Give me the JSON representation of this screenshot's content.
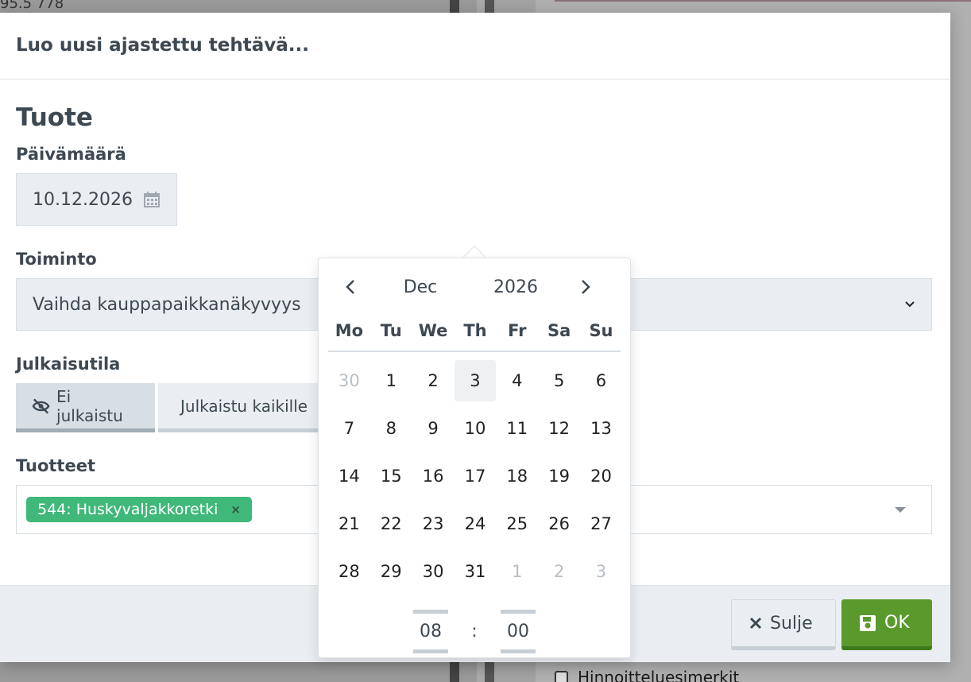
{
  "background": {
    "top_text": "95.5      778",
    "checkbox_label": "Hinnoitteluesimerkit"
  },
  "modal": {
    "title": "Luo uusi ajastettu tehtävä...",
    "section_title": "Tuote",
    "date": {
      "label": "Päivämäärä",
      "value": "10.12.2026",
      "icon": "calendar-icon"
    },
    "action": {
      "label": "Toiminto",
      "selected": "Vaihda kauppapaikkanäkyvyys",
      "icon": "chevron-down-icon"
    },
    "publish": {
      "label": "Julkaisutila",
      "options": [
        {
          "label": "Ei julkaistu",
          "icon": "eye-slash-icon",
          "active": true
        },
        {
          "label": "Julkaistu kaikille",
          "icon": "globe-icon",
          "active": false
        }
      ]
    },
    "products": {
      "label": "Tuotteet",
      "tags": [
        {
          "label": "544: Huskyvaljakkoretki",
          "remove": "×"
        }
      ]
    },
    "footer": {
      "close_label": "Sulje",
      "ok_label": "OK"
    }
  },
  "datepicker": {
    "month": "Dec",
    "year": "2026",
    "weekdays": [
      "Mo",
      "Tu",
      "We",
      "Th",
      "Fr",
      "Sa",
      "Su"
    ],
    "weeks": [
      [
        "30",
        "1",
        "2",
        "3",
        "4",
        "5",
        "6"
      ],
      [
        "7",
        "8",
        "9",
        "10",
        "11",
        "12",
        "13"
      ],
      [
        "14",
        "15",
        "16",
        "17",
        "18",
        "19",
        "20"
      ],
      [
        "21",
        "22",
        "23",
        "24",
        "25",
        "26",
        "27"
      ],
      [
        "28",
        "29",
        "30",
        "31",
        "1",
        "2",
        "3"
      ]
    ],
    "muted_first_week": [
      0
    ],
    "muted_last_week": [
      4,
      5,
      6
    ],
    "today": "3",
    "hour": "08",
    "minute": "00",
    "time_separator": ":"
  },
  "colors": {
    "accent_green": "#3fb87a",
    "ok_green": "#5a9a2d",
    "text": "#3d4852"
  }
}
